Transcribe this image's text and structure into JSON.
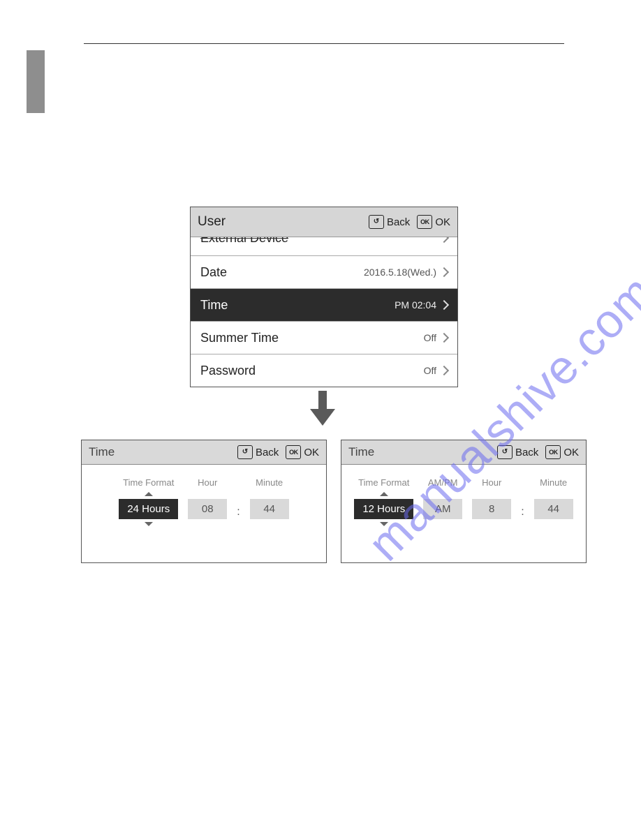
{
  "header": {
    "back_label": "Back",
    "ok_label": "OK"
  },
  "user_panel": {
    "title": "User",
    "rows": {
      "external": {
        "label": "External Device",
        "value": ""
      },
      "date": {
        "label": "Date",
        "value": "2016.5.18(Wed.)"
      },
      "time": {
        "label": "Time",
        "value": "PM 02:04"
      },
      "summer": {
        "label": "Summer Time",
        "value": "Off"
      },
      "password": {
        "label": "Password",
        "value": "Off"
      }
    }
  },
  "time_panels": {
    "title": "Time",
    "labels": {
      "format": "Time Format",
      "ampm": "AM/PM",
      "hour": "Hour",
      "minute": "Minute"
    },
    "a": {
      "format": "24 Hours",
      "hour": "08",
      "minute": "44"
    },
    "b": {
      "format": "12 Hours",
      "ampm": "AM",
      "hour": "8",
      "minute": "44"
    }
  },
  "watermark": "manualshive.com"
}
